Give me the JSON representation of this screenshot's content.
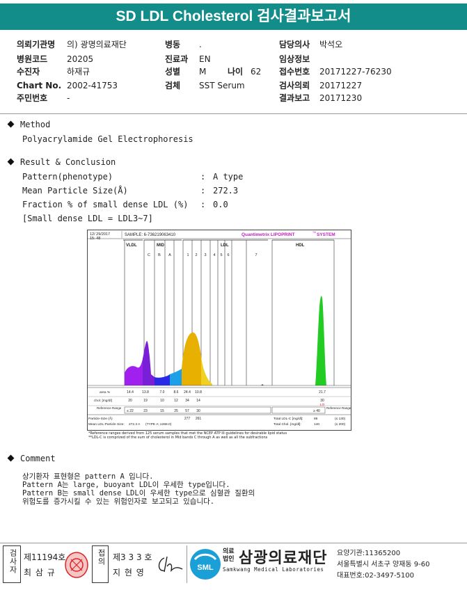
{
  "title": "SD LDL Cholesterol 검사결과보고서",
  "info": {
    "col1": [
      {
        "label": "의뢰기관명",
        "value": "의) 광명의료재단"
      },
      {
        "label": "병원코드",
        "value": "20205"
      },
      {
        "label": "수진자",
        "value": "하재규"
      },
      {
        "label": "Chart No.",
        "value": "2002-41753"
      },
      {
        "label": "주민번호",
        "value": "-"
      }
    ],
    "col2": [
      {
        "label": "병동",
        "value": "."
      },
      {
        "label": "진료과",
        "value": "EN"
      },
      {
        "label": "성별",
        "value": "M"
      },
      {
        "label": "검체",
        "value": "SST Serum"
      }
    ],
    "age": {
      "label": "나이",
      "value": "62"
    },
    "col3": [
      {
        "label": "담당의사",
        "value": "박석오"
      },
      {
        "label": "임상정보",
        "value": ""
      },
      {
        "label": "접수번호",
        "value": "20171227-76230"
      },
      {
        "label": "검사의뢰",
        "value": "20171227"
      },
      {
        "label": "결과보고",
        "value": "20171230"
      }
    ]
  },
  "method": {
    "heading": "Method",
    "text": "Polyacrylamide Gel Electrophoresis"
  },
  "result": {
    "heading": "Result & Conclusion",
    "rows": [
      {
        "label": "Pattern(phenotype)",
        "colon": ":",
        "value": "A type"
      },
      {
        "label": "Mean Particle Size(Å)",
        "colon": ":",
        "value": "272.3"
      },
      {
        "label": "Fraction % of small dense LDL (%)",
        "colon": ":",
        "value": "0.0"
      }
    ],
    "note": "[Small dense LDL = LDL3~7]"
  },
  "chart_data": {
    "type": "area",
    "header": {
      "date": "12/ 29/2017",
      "time": "15: 48",
      "sample": "SAMPLE:   6-736219063410",
      "brand": "Quantimetrix LIPOPRINT",
      "brand_tm": "TM",
      "brand_suffix": " SYSTEM"
    },
    "groups": [
      "VLDL",
      "MID",
      "LDL",
      "HDL"
    ],
    "bands": [
      "C",
      "B",
      "A",
      "1",
      "2",
      "3",
      "4",
      "5",
      "6",
      "7"
    ],
    "row_labels": {
      "area": "area %",
      "chol": "chol. [mg/dl]",
      "ref": "Reference\nRange",
      "ref_right": "Reference\nRange"
    },
    "area_pct": [
      "14.4",
      "13.8",
      "7.0",
      "8.6",
      "24.4",
      "10.8",
      "21.7"
    ],
    "chol_mg": [
      "20",
      "19",
      "10",
      "12",
      "34",
      "14",
      "30"
    ],
    "hdl_flag": "LO",
    "ref_range": [
      "≤ 22",
      "23",
      "15",
      "25",
      "57",
      "30"
    ],
    "hdl_ref": "≥ 40",
    "particle_size": {
      "label": "Particle-Size (Å)",
      "values": [
        "277",
        "261"
      ]
    },
    "mean_size": {
      "label": "Mean LDL-Particle Size:",
      "value": "272.3 A",
      "pattern": "(TYPE A; ≥268.0)"
    },
    "totals": [
      {
        "label": "Total LDL-C [mg/dl]:",
        "value": "89",
        "limit": "(≤ 130)"
      },
      {
        "label": "Total Chol. [mg/dl]:",
        "value": "140",
        "limit": "(≤ 200)"
      }
    ],
    "footnotes": [
      "*Reference ranges derived from 125 serum samples that met the NCEP ATP III guidelines for desirable lipid status",
      "**LDL-C is comprized of the sum of cholesterol in Mid bands C through A as well as all the subfractions"
    ],
    "colors": {
      "vldl": "#a020f0",
      "mid_c": "#7a1fd8",
      "mid_b": "#2a2ae6",
      "mid_a": "#1da0e8",
      "ldl1": "#e8b000",
      "ldl2": "#f0d020",
      "hdl": "#22cc22"
    }
  },
  "comment": {
    "heading": "Comment",
    "lines": [
      "상기환자 표현형은 pattern A 입니다.",
      "Pattern A는 large, buoyant LDL이 우세한 type입니다.",
      "Pattern B는 small dense LDL이 우세한 type으로 심혈관 질환의",
      "위험도를 증가시킬 수 있는 위험인자로 보고되고 있습니다."
    ]
  },
  "footer": {
    "left_tag": "검사자",
    "left_license": "제11194호",
    "left_name": "최 삼 규",
    "mid_tag": "접의",
    "mid_license": "제3 3 3 호",
    "mid_name": "지 현 영",
    "org_prefix_1": "의료",
    "org_prefix_2": "법인",
    "org_name": "삼광의료재단",
    "org_en": "Samkwang Medical Laboratories",
    "logo_text": "SML",
    "institution_no": "요양기관:11365200",
    "address": "서울특별시 서초구 양재동 9-60",
    "phone": "대표번호:02-3497-5100",
    "brand_color": "#1a9fd6"
  }
}
